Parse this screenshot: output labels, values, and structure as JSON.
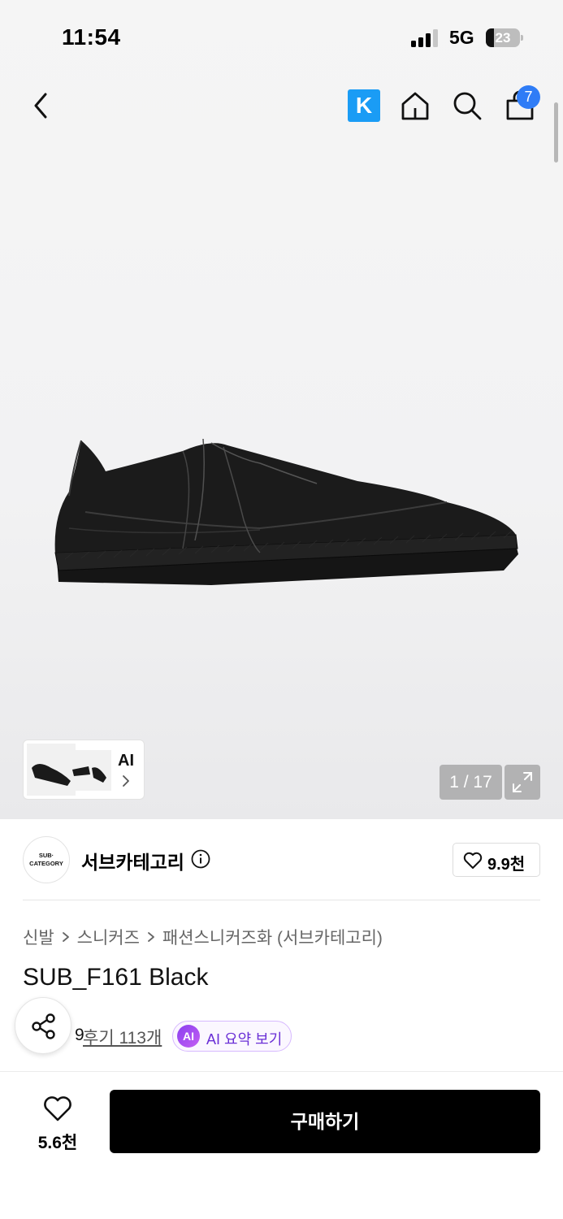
{
  "status_bar": {
    "time": "11:54",
    "network": "5G",
    "battery": "23"
  },
  "nav": {
    "brand_logo_letter": "K",
    "cart_count": "7"
  },
  "gallery": {
    "counter": "1 / 17",
    "ai_label": "AI"
  },
  "brand": {
    "logo_line1": "SUB·",
    "logo_line2": "CATEGORY",
    "name": "서브카테고리",
    "likes": "9.9천"
  },
  "breadcrumb": [
    "신발",
    "스니커즈",
    "패션스니커즈화 (서브카테고리)"
  ],
  "product": {
    "title": "SUB_F161 Black",
    "rating_partial": "9",
    "review_link": "후기 113개",
    "ai_badge": "AI",
    "ai_summary": "AI 요약 보기"
  },
  "bottom": {
    "wish_count": "5.6천",
    "buy_label": "구매하기"
  },
  "colors": {
    "accent_blue": "#1a9cf5",
    "badge_blue": "#2f7cf6",
    "ai_purple": "#8a3ff0",
    "buy_black": "#000000"
  }
}
